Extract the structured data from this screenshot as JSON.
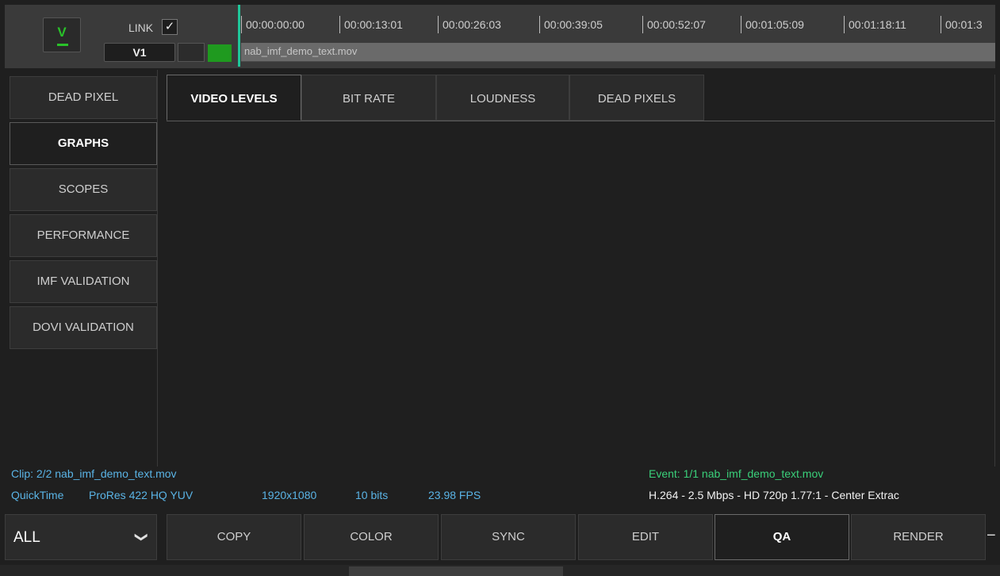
{
  "track_header": {
    "v_button_label": "V",
    "link_label": "LINK",
    "link_checked_glyph": "✓",
    "track_name": "V1"
  },
  "timeline": {
    "timecodes": [
      "00:00:00:00",
      "00:00:13:01",
      "00:00:26:03",
      "00:00:39:05",
      "00:00:52:07",
      "00:01:05:09",
      "00:01:18:11",
      "00:01:3"
    ],
    "clip_name": "nab_imf_demo_text.mov"
  },
  "sidebar": {
    "items": [
      {
        "label": "DEAD PIXEL"
      },
      {
        "label": "GRAPHS"
      },
      {
        "label": "SCOPES"
      },
      {
        "label": "PERFORMANCE"
      },
      {
        "label": "IMF VALIDATION"
      },
      {
        "label": "DOVI VALIDATION"
      }
    ]
  },
  "tabs": [
    {
      "label": "VIDEO LEVELS"
    },
    {
      "label": "BIT RATE"
    },
    {
      "label": "LOUDNESS"
    },
    {
      "label": "DEAD PIXELS"
    }
  ],
  "clip_info": {
    "clip_line": "Clip: 2/2   nab_imf_demo_text.mov",
    "format": "QuickTime",
    "codec": "ProRes 422 HQ YUV",
    "resolution": "1920x1080",
    "bit_depth": "10 bits",
    "fps": "23.98 FPS"
  },
  "event_info": {
    "event_line": "Event: 1/1   nab_imf_demo_text.mov",
    "details": "H.264 - 2.5 Mbps - HD 720p 1.77:1 - Center Extrac"
  },
  "bottom": {
    "filter_value": "ALL",
    "filter_arrow": "❯",
    "buttons": [
      {
        "label": "COPY"
      },
      {
        "label": "COLOR"
      },
      {
        "label": "SYNC"
      },
      {
        "label": "EDIT"
      },
      {
        "label": "QA"
      },
      {
        "label": "RENDER"
      }
    ],
    "extra_glyph": "−"
  },
  "colors": {
    "accent_green": "#29c129",
    "playhead": "#1fc79a",
    "clip_info_blue": "#5ab4e6",
    "event_green": "#3ad07a"
  }
}
